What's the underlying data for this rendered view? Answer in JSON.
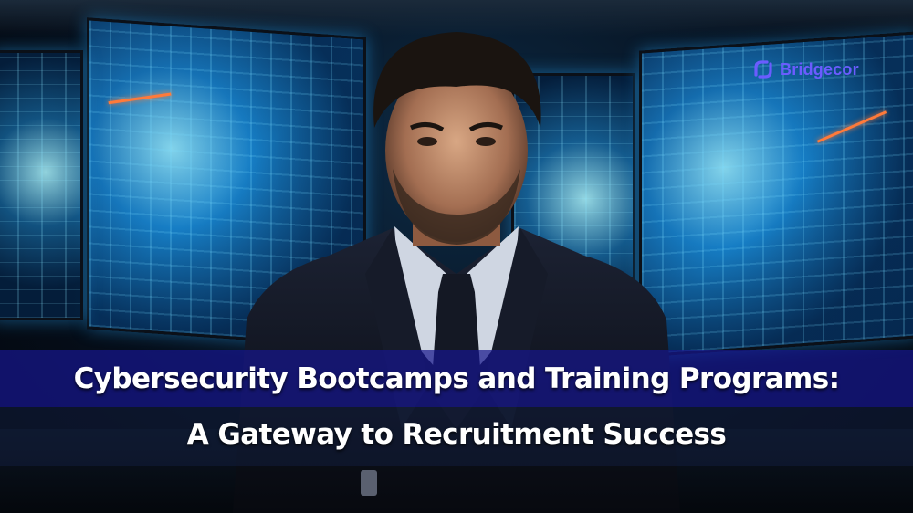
{
  "brand": {
    "name": "Bridgecor",
    "color": "#6b5cff",
    "icon": "bridgecor-logo-icon"
  },
  "headline": {
    "line1": "Cybersecurity Bootcamps and Training Programs:",
    "line2": "A Gateway to Recruitment Success"
  },
  "colors": {
    "banner_primary": "#16168c",
    "screen_glow": "#2ab0ff",
    "accent_line": "#ff7a3a"
  }
}
